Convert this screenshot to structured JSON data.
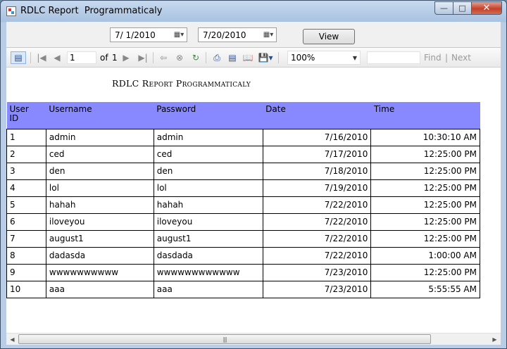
{
  "window": {
    "title": "RDLC Report  Programmaticaly"
  },
  "filters": {
    "start_date": "7/ 1/2010",
    "end_date": "7/20/2010",
    "view_label": "View"
  },
  "toolbar": {
    "page_current": "1",
    "page_of": "of",
    "page_total": "1",
    "zoom": "100%",
    "find_label": "Find",
    "separator": "|",
    "next_label": "Next"
  },
  "report": {
    "title": "RDLC Report Programmaticaly",
    "columns": [
      "User ID",
      "Username",
      "Password",
      "Date",
      "Time"
    ],
    "rows": [
      [
        "1",
        "admin",
        "admin",
        "7/16/2010",
        "10:30:10 AM"
      ],
      [
        "2",
        "ced",
        "ced",
        "7/17/2010",
        "12:25:00 PM"
      ],
      [
        "3",
        "den",
        "den",
        "7/18/2010",
        "12:25:00 PM"
      ],
      [
        "4",
        "lol",
        "lol",
        "7/19/2010",
        "12:25:00 PM"
      ],
      [
        "5",
        "hahah",
        "hahah",
        "7/22/2010",
        "12:25:00 PM"
      ],
      [
        "6",
        "iloveyou",
        "iloveyou",
        "7/22/2010",
        "12:25:00 PM"
      ],
      [
        "7",
        "august1",
        "august1",
        "7/22/2010",
        "12:25:00 PM"
      ],
      [
        "8",
        "dadasda",
        "dasdada",
        "7/22/2010",
        "1:00:00 AM"
      ],
      [
        "9",
        "wwwwwwwwww",
        "wwwwwwwwwwww",
        "7/23/2010",
        "12:25:00 PM"
      ],
      [
        "10",
        "aaa",
        "aaa",
        "7/23/2010",
        "5:55:55 AM"
      ]
    ]
  },
  "colors": {
    "header_bg": "#8888ff",
    "close_button": "#c2412c"
  }
}
